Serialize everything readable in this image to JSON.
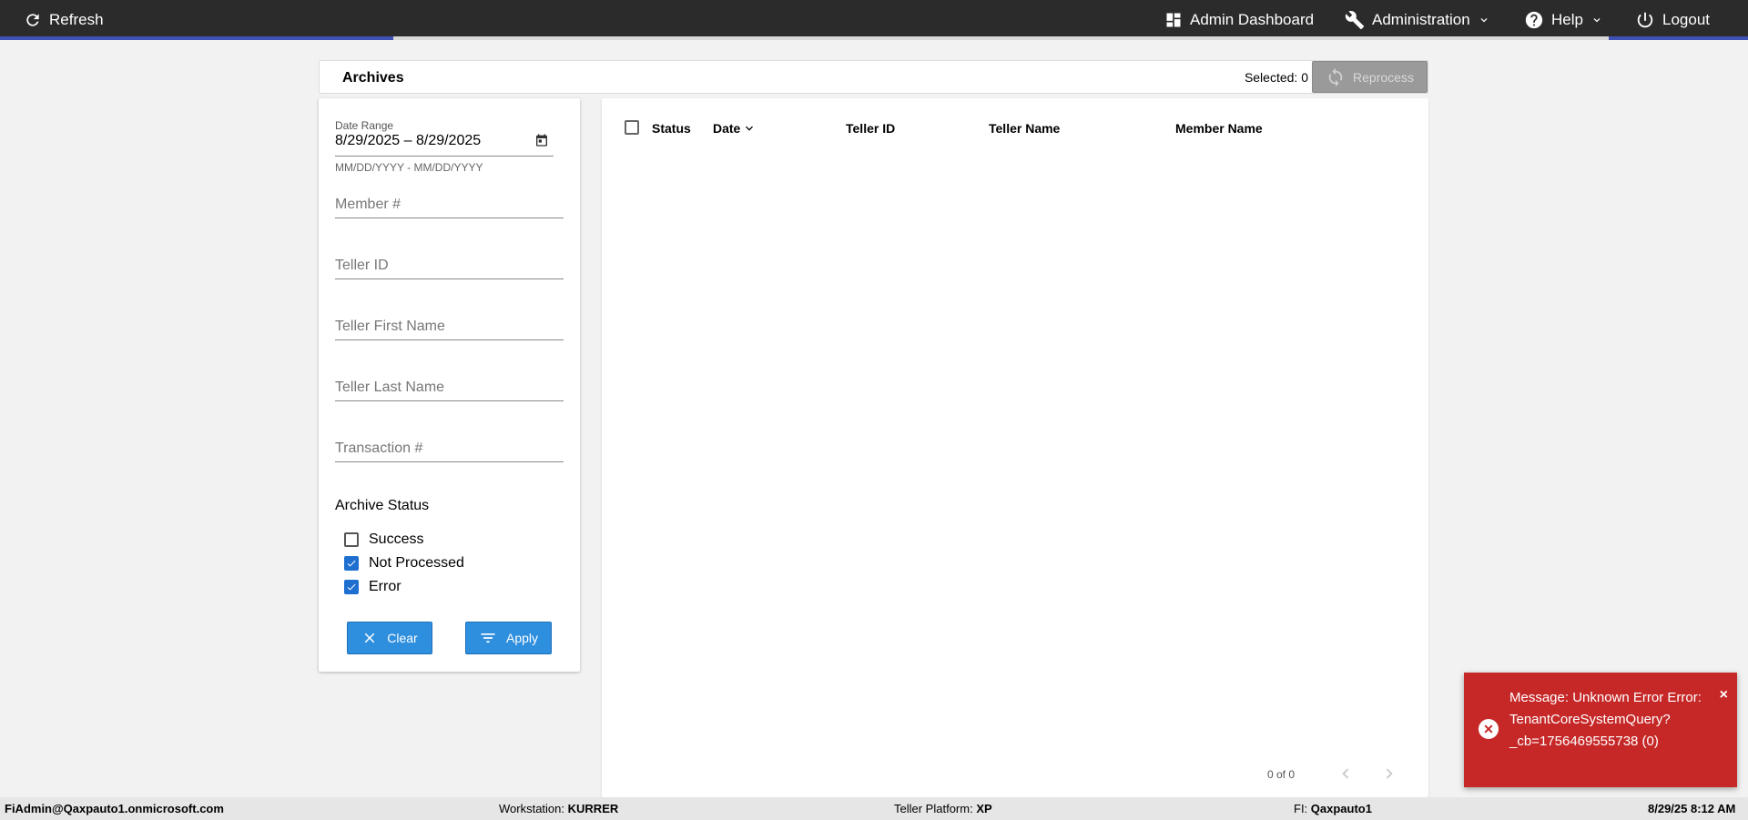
{
  "topbar": {
    "refresh_label": "Refresh",
    "admin_dashboard_label": "Admin Dashboard",
    "administration_label": "Administration",
    "help_label": "Help",
    "logout_label": "Logout"
  },
  "archives": {
    "title": "Archives",
    "selected_label": "Selected: 0",
    "reprocess_label": "Reprocess"
  },
  "filters": {
    "date_range_label": "Date Range",
    "date_range_value": "8/29/2025 – 8/29/2025",
    "date_hint": "MM/DD/YYYY - MM/DD/YYYY",
    "member_placeholder": "Member #",
    "teller_id_placeholder": "Teller ID",
    "teller_first_placeholder": "Teller First Name",
    "teller_last_placeholder": "Teller Last Name",
    "transaction_placeholder": "Transaction #",
    "archive_status_label": "Archive Status",
    "status_options": [
      {
        "label": "Success",
        "checked": false
      },
      {
        "label": "Not Processed",
        "checked": true
      },
      {
        "label": "Error",
        "checked": true
      }
    ],
    "clear_label": "Clear",
    "apply_label": "Apply"
  },
  "grid": {
    "columns": [
      "Status",
      "Date",
      "Teller ID",
      "Teller Name",
      "Member Name"
    ],
    "rows": [],
    "pager_text": "0 of 0"
  },
  "toast": {
    "message": "Message: Unknown Error Error: TenantCoreSystemQuery?_cb=1756469555738 (0)",
    "close_glyph": "×",
    "bg_color": "#c62828"
  },
  "footer": {
    "user": "FiAdmin@Qaxpauto1.onmicrosoft.com",
    "workstation_label": "Workstation:",
    "workstation_value": "KURRER",
    "platform_label": "Teller Platform:",
    "platform_value": "XP",
    "fi_label": "FI:",
    "fi_value": "Qaxpauto1",
    "datetime": "8/29/25 8:12 AM"
  },
  "colors": {
    "accent": "#2f8fdf",
    "topbar": "#2b2b2b",
    "progress": "#3f51b5"
  },
  "icons": [
    "refresh-icon",
    "dashboard-icon",
    "wrench-icon",
    "help-icon",
    "power-icon",
    "calendar-icon",
    "sync-icon",
    "close-icon",
    "filter-icon",
    "error-icon",
    "chevron-down-icon",
    "chevron-left-icon",
    "chevron-right-icon"
  ]
}
